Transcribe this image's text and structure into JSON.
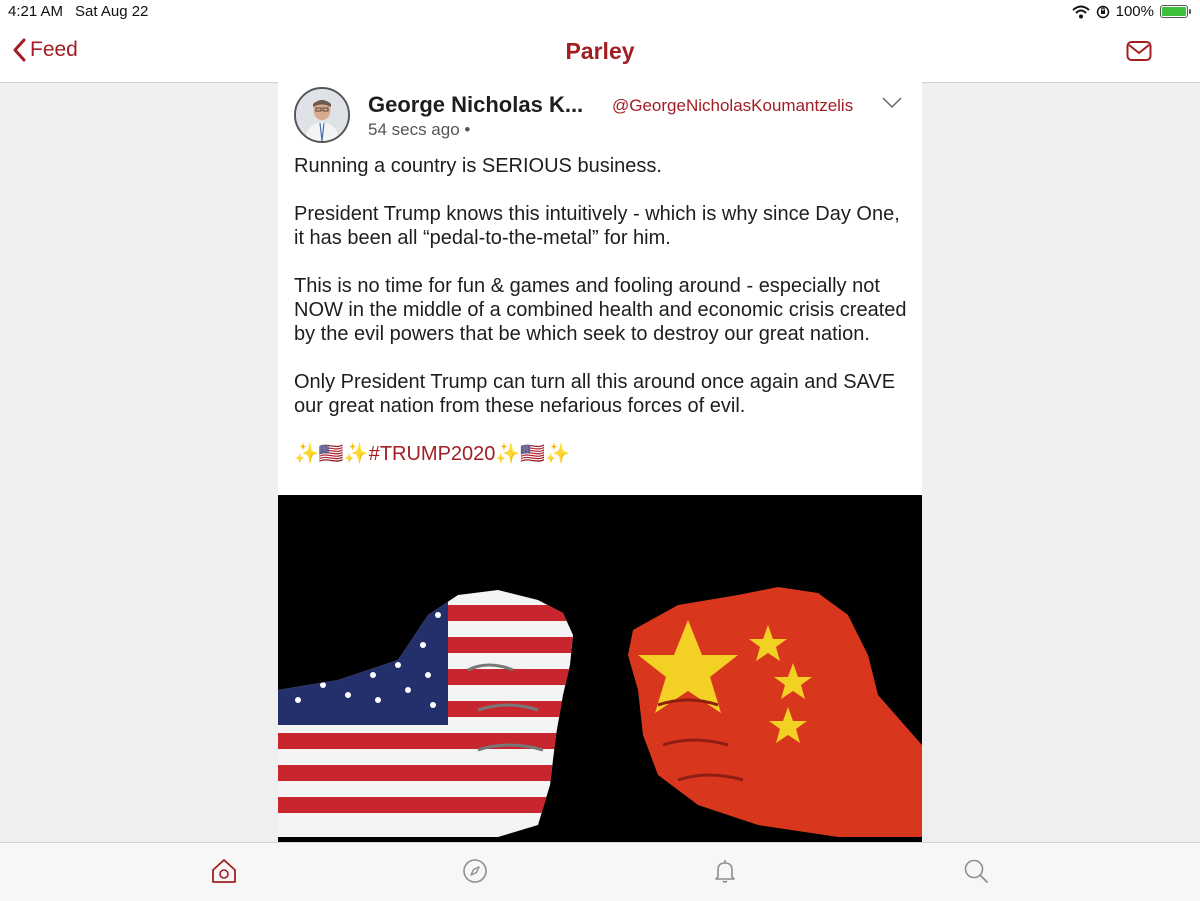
{
  "status_bar": {
    "time": "4:21 AM",
    "date": "Sat Aug 22",
    "battery": "100%",
    "battery_level": 1.0
  },
  "nav": {
    "back_label": "Feed",
    "title": "Parley",
    "right_icon": "mail-icon"
  },
  "post": {
    "author_name": "George Nicholas K...",
    "author_handle": "@GeorgeNicholasKoumantzelis",
    "timestamp": "54 secs ago",
    "paragraphs": [
      "Running a country is SERIOUS business.",
      "President Trump knows this intuitively - which is why since Day One, it has been all “pedal-to-the-metal” for him.",
      "This is no time for fun & games and fooling around - especially not NOW in the middle of a combined health and economic crisis created by the evil powers that be which seek to destroy our great nation.",
      "Only President Trump can turn all this around once again and SAVE our great nation from these nefarious forces of evil."
    ],
    "hashtag_line": "✨🇺🇸✨#TRUMP2020✨🇺🇸✨"
  },
  "tabs": [
    {
      "icon": "home-icon",
      "active": true
    },
    {
      "icon": "compass-icon",
      "active": false
    },
    {
      "icon": "bell-icon",
      "active": false
    },
    {
      "icon": "search-icon",
      "active": false
    }
  ],
  "colors": {
    "accent": "#a11e23",
    "inactive_icon": "#8e8e93",
    "background": "#efefef"
  }
}
